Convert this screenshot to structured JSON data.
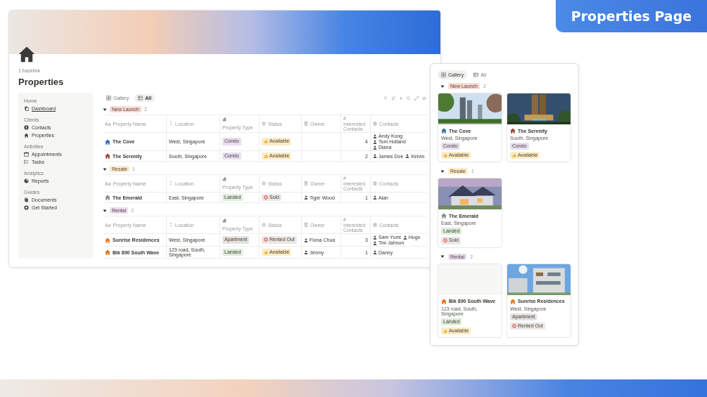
{
  "badge": {
    "title": "Properties Page"
  },
  "page": {
    "backlink": "1 backlink",
    "title": "Properties",
    "sidebar": [
      {
        "heading": "Home",
        "items": [
          {
            "label": "Dashboard",
            "kind": "link"
          }
        ]
      },
      {
        "heading": "Clients",
        "items": [
          {
            "label": "Contacts",
            "kind": "page"
          },
          {
            "label": "Properties",
            "kind": "page"
          }
        ]
      },
      {
        "heading": "Activities",
        "items": [
          {
            "label": "Appointments",
            "kind": "page"
          },
          {
            "label": "Tasks",
            "kind": "page"
          }
        ]
      },
      {
        "heading": "Analytics",
        "items": [
          {
            "label": "Reports",
            "kind": "page"
          }
        ]
      },
      {
        "heading": "Guides",
        "items": [
          {
            "label": "Documents",
            "kind": "page"
          },
          {
            "label": "Get Started",
            "kind": "page"
          }
        ]
      }
    ],
    "views": [
      {
        "label": "Gallery",
        "selected": false
      },
      {
        "label": "All",
        "selected": true
      }
    ],
    "groups": [
      {
        "label": "New Launch",
        "count": "2",
        "color": "#f8dcd6",
        "columns": [
          {
            "glyph": "Aa",
            "label": "Property Name"
          },
          {
            "label": "Location"
          },
          {
            "label": "Property Type"
          },
          {
            "label": "Status"
          },
          {
            "label": "Owner"
          },
          {
            "glyph": "#",
            "label": "Interested Contacts"
          },
          {
            "label": "Contacts"
          }
        ],
        "rows": [
          {
            "name": "The Cove",
            "color": "#2e6db4",
            "location": "West, Singapore",
            "type": {
              "label": "Condo",
              "color": "#e8def2"
            },
            "status": {
              "label": "Available",
              "kind": "available"
            },
            "interested": "4",
            "contacts": [
              "Andy Kong",
              "Tom Holland",
              "Diana"
            ]
          },
          {
            "name": "The Serenity",
            "color": "#9a4a36",
            "location": "South, Singapore",
            "type": {
              "label": "Condo",
              "color": "#e8def2"
            },
            "status": {
              "label": "Available",
              "kind": "available"
            },
            "interested": "2",
            "contacts": [
              "James Doe",
              "Kelvin"
            ]
          }
        ]
      },
      {
        "label": "Resale",
        "count": "1",
        "color": "#fbeccb",
        "columns": [
          {
            "glyph": "Aa",
            "label": "Property Name"
          },
          {
            "label": "Location"
          },
          {
            "label": "Property Type"
          },
          {
            "label": "Status"
          },
          {
            "label": "Owner"
          },
          {
            "glyph": "#",
            "label": "Interested Contacts"
          },
          {
            "label": "Contacts"
          }
        ],
        "rows": [
          {
            "name": "The Emerald",
            "color": "#8c8c86",
            "location": "East, Singapore",
            "type": {
              "label": "Landed",
              "color": "#dbeddb"
            },
            "status": {
              "label": "Sold",
              "kind": "sold"
            },
            "owner": "Tiger Wood",
            "interested": "1",
            "contacts": [
              "Alan"
            ]
          }
        ]
      },
      {
        "label": "Rental",
        "count": "2",
        "color": "#e8def2",
        "columns": [
          {
            "glyph": "Aa",
            "label": "Property Name"
          },
          {
            "label": "Location"
          },
          {
            "label": "Property Type"
          },
          {
            "label": "Status"
          },
          {
            "label": "Owner"
          },
          {
            "glyph": "#",
            "label": "Interested Contacts"
          },
          {
            "label": "Contacts"
          }
        ],
        "rows": [
          {
            "name": "Sunrise Residences",
            "color": "#e07b24",
            "location": "West, Singapore",
            "type": {
              "label": "Apartment",
              "color": "#e3e2e0"
            },
            "status": {
              "label": "Rented Out",
              "kind": "rented"
            },
            "owner": "Fiona Chua",
            "interested": "3",
            "contacts": [
              "Sam Yumi",
              "Hugo",
              "Tim Jahnon"
            ]
          },
          {
            "name": "Blk 890 South Wave",
            "color": "#e0701c",
            "location": "123 road, South, Singapore",
            "type": {
              "label": "Landed",
              "color": "#dbeddb"
            },
            "status": {
              "label": "Available",
              "kind": "available"
            },
            "owner": "Jimmy",
            "interested": "1",
            "contacts": [
              "Danny"
            ]
          }
        ]
      }
    ]
  },
  "gallery": {
    "views": [
      {
        "label": "Gallery",
        "selected": true
      },
      {
        "label": "All",
        "selected": false
      }
    ],
    "groups": [
      {
        "label": "New Launch",
        "count": "2",
        "color": "#f8dcd6",
        "cards": [
          {
            "name": "The Cove",
            "color": "#2e6db4",
            "location": "West, Singapore",
            "type": {
              "label": "Condo",
              "color": "#e8def2"
            },
            "status": {
              "label": "Available",
              "kind": "available"
            },
            "photo": true
          },
          {
            "name": "The Serenity",
            "color": "#9a4a36",
            "location": "South, Singapore",
            "type": {
              "label": "Condo",
              "color": "#e8def2"
            },
            "status": {
              "label": "Available",
              "kind": "available"
            },
            "photo": true
          }
        ]
      },
      {
        "label": "Resale",
        "count": "1",
        "color": "#fbeccb",
        "cards": [
          {
            "name": "The Emerald",
            "color": "#8c8c86",
            "location": "East, Singapore",
            "type": {
              "label": "Landed",
              "color": "#dbeddb"
            },
            "status": {
              "label": "Sold",
              "kind": "sold"
            },
            "photo": true
          }
        ]
      },
      {
        "label": "Rental",
        "count": "2",
        "color": "#e8def2",
        "cards": [
          {
            "name": "Blk 890 South Wave",
            "color": "#e0701c",
            "location": "123 road, South, Singapore",
            "type": {
              "label": "Landed",
              "color": "#dbeddb"
            },
            "status": {
              "label": "Available",
              "kind": "available"
            },
            "photo": false
          },
          {
            "name": "Sunrise Residences",
            "color": "#e07b24",
            "location": "West, Singapore",
            "type": {
              "label": "Apartment",
              "color": "#e3e2e0"
            },
            "status": {
              "label": "Rented Out",
              "kind": "rented"
            },
            "photo": true
          }
        ]
      }
    ]
  }
}
